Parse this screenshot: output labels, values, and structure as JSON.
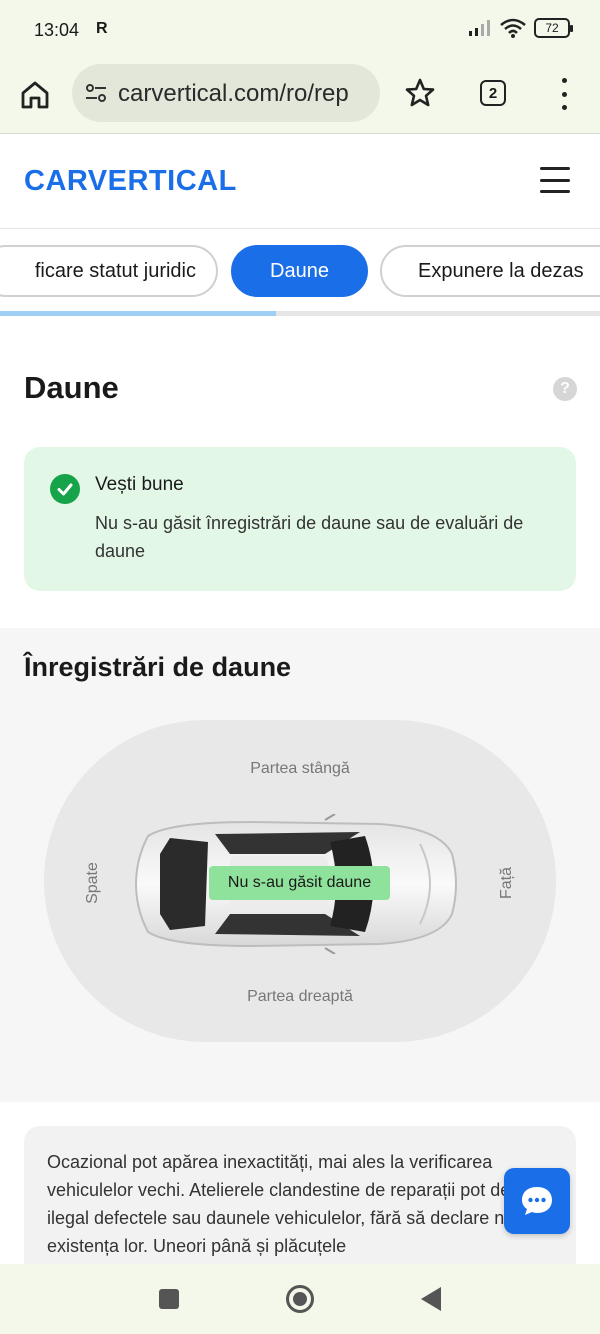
{
  "status_bar": {
    "time": "13:04",
    "carrier_icon": "R",
    "battery": "72"
  },
  "browser": {
    "url": "carvertical.com/ro/rep",
    "tab_count": "2"
  },
  "site": {
    "logo": "CARVERTICAL"
  },
  "tabs": [
    {
      "label": "ficare statut juridic",
      "active": false
    },
    {
      "label": "Daune",
      "active": true
    },
    {
      "label": "Expunere la dezas",
      "active": false
    }
  ],
  "progress_fraction": 0.46,
  "daune": {
    "title": "Daune",
    "help": "?",
    "good_news_title": "Vești bune",
    "good_news_text": "Nu s-au găsit înregistrări de daune sau de evaluări de daune"
  },
  "records": {
    "title": "Înregistrări de daune",
    "left_side": "Partea stângă",
    "right_side": "Partea dreaptă",
    "back": "Spate",
    "front": "Față",
    "status": "Nu s-au găsit daune"
  },
  "disclaimer": {
    "text": "Ocazional pot apărea inexactități, mai ales la verificarea vehiculelor vechi. Atelierele clandestine de reparații pot deghiza ilegal defectele sau daunele vehiculelor, fără să declare nicăieri existența lor. Uneori până și plăcuțele"
  },
  "colors": {
    "brand_blue": "#1a6fe8",
    "success_green": "#16a34a",
    "good_news_bg": "#e3f7e6",
    "no_damage_badge": "#8ee29b"
  }
}
